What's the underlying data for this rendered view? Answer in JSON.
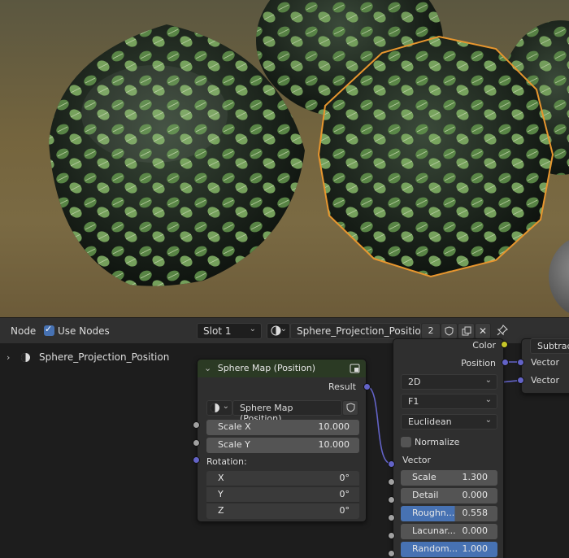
{
  "header": {
    "node_menu": "Node",
    "use_nodes_label": "Use Nodes",
    "use_nodes_checked": true,
    "slot_dropdown": "Slot 1",
    "material_name": "Sphere_Projection_Position",
    "user_count": "2"
  },
  "outliner": {
    "material_item": "Sphere_Projection_Position"
  },
  "sphere_node": {
    "title": "Sphere Map (Position)",
    "output_label": "Result",
    "group_name": "Sphere Map (Position)",
    "scale_x_label": "Scale X",
    "scale_x_value": "10.000",
    "scale_y_label": "Scale Y",
    "scale_y_value": "10.000",
    "rotation_label": "Rotation:",
    "rot_x_label": "X",
    "rot_x_value": "0°",
    "rot_y_label": "Y",
    "rot_y_value": "0°",
    "rot_z_label": "Z",
    "rot_z_value": "0°"
  },
  "voronoi_node": {
    "color_label": "Color",
    "position_label": "Position",
    "dimensions": "2D",
    "feature": "F1",
    "distance": "Euclidean",
    "normalize_label": "Normalize",
    "vector_label": "Vector",
    "scale_label": "Scale",
    "scale_value": "1.300",
    "detail_label": "Detail",
    "detail_value": "0.000",
    "roughness_label": "Roughn...",
    "roughness_value": "0.558",
    "roughness_fill": 0.558,
    "lacunarity_label": "Lacunar...",
    "lacunarity_value": "0.000",
    "randomness_label": "Random...",
    "randomness_value": "1.000",
    "randomness_fill": 1.0
  },
  "math_node": {
    "operation": "Subtrac",
    "input1_label": "Vector",
    "input2_label": "Vector"
  },
  "colors": {
    "accent": "#4772b3",
    "selection_outline": "#e8962e",
    "vector_socket": "#6363c7",
    "float_socket": "#a1a1a1",
    "color_socket": "#c7c729",
    "group_node_header": "#2b3a24"
  }
}
